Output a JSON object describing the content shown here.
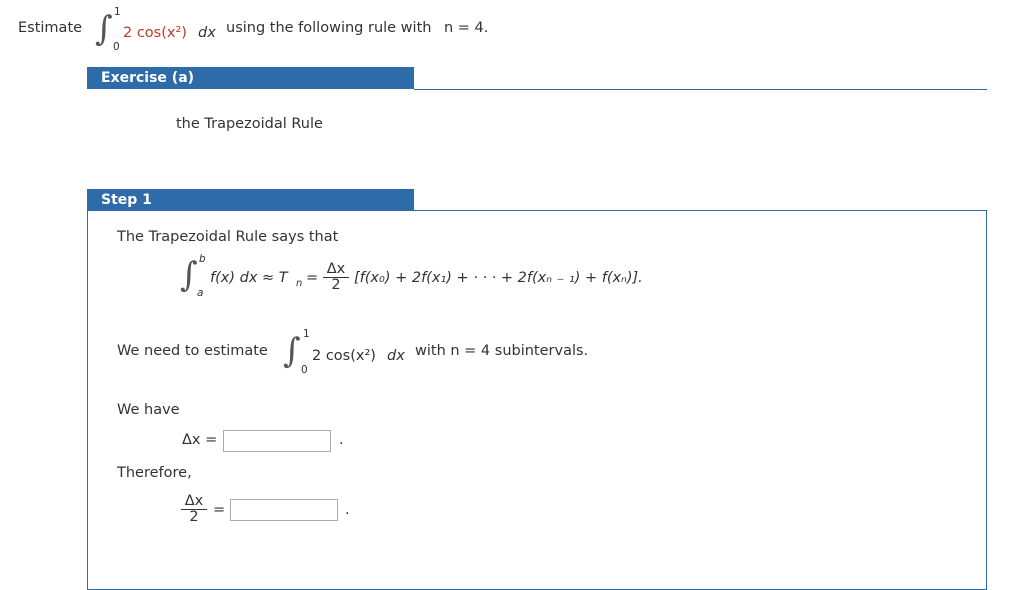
{
  "problem": {
    "prefix": "Estimate",
    "upper_limit": "1",
    "lower_limit": "0",
    "integrand": "2 cos(x²)",
    "dx": "dx",
    "suffix": "using the following rule with",
    "n_expr": "n = 4."
  },
  "exercise": {
    "header": "Exercise (a)",
    "rule_name": "the Trapezoidal Rule"
  },
  "step": {
    "header": "Step 1",
    "intro": "The Trapezoidal Rule says that",
    "formula": {
      "upper": "b",
      "lower": "a",
      "lhs": "f(x) dx ≈ T",
      "lhs_sub": "n",
      "eq": "=",
      "frac_num": "Δx",
      "frac_den": "2",
      "rhs": "[f(x₀) + 2f(x₁) + · · · + 2f(xₙ ₋ ₁) + f(xₙ)]."
    },
    "estimate_prefix": "We need to estimate",
    "estimate_upper": "1",
    "estimate_lower": "0",
    "estimate_integrand": "2 cos(x²)",
    "estimate_dx": "dx",
    "estimate_suffix": "with n = 4 subintervals.",
    "we_have": "We have",
    "delta_label": "Δx =",
    "delta_value": "",
    "therefore": "Therefore,",
    "frac2_num": "Δx",
    "frac2_den": "2",
    "frac2_eq": "=",
    "frac2_value": "",
    "period": "."
  }
}
